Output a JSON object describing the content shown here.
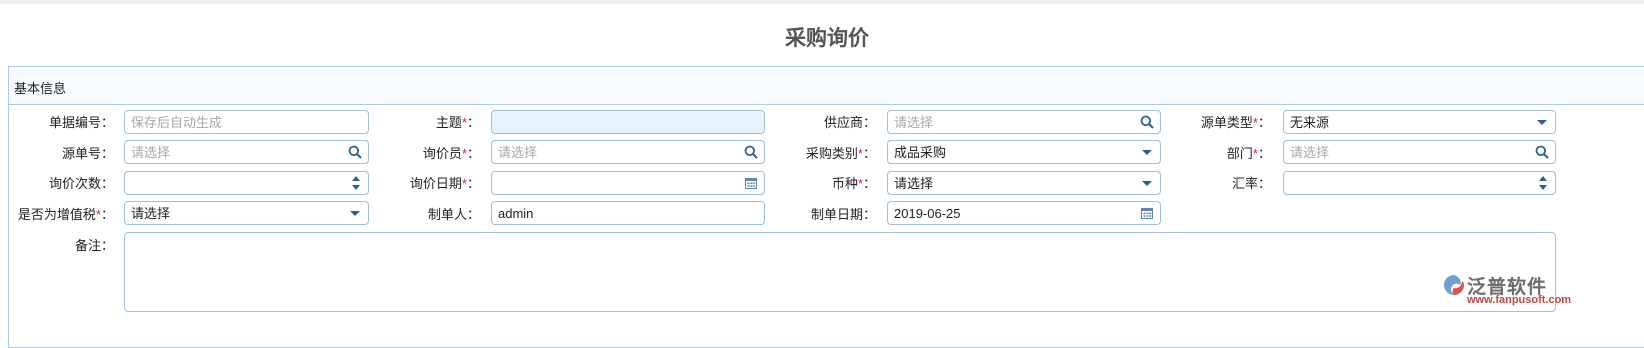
{
  "page": {
    "title": "采购询价"
  },
  "section": {
    "title": "基本信息"
  },
  "fields": {
    "doc_no": {
      "label": "单据编号：",
      "placeholder": "保存后自动生成"
    },
    "subject": {
      "label": "主题",
      "value": ""
    },
    "supplier": {
      "label": "供应商：",
      "placeholder": "请选择"
    },
    "source_type": {
      "label": "源单类型",
      "value": "无来源"
    },
    "source_no": {
      "label": "源单号：",
      "placeholder": "请选择"
    },
    "inquirer": {
      "label": "询价员",
      "placeholder": "请选择"
    },
    "purchase_category": {
      "label": "采购类别",
      "value": "成品采购"
    },
    "department": {
      "label": "部门",
      "placeholder": "请选择"
    },
    "inquiry_count": {
      "label": "询价次数：",
      "value": ""
    },
    "inquiry_date": {
      "label": "询价日期",
      "value": ""
    },
    "currency": {
      "label": "币种",
      "value": "请选择"
    },
    "exchange_rate": {
      "label": "汇率：",
      "value": ""
    },
    "vat": {
      "label": "是否为增值税",
      "value": "请选择"
    },
    "creator": {
      "label": "制单人：",
      "value": "admin"
    },
    "create_date": {
      "label": "制单日期：",
      "value": "2019-06-25"
    },
    "remark": {
      "label": "备注：",
      "value": ""
    }
  },
  "required_mark": "*",
  "required_suffix": "：",
  "logo": {
    "name": "泛普软件",
    "url": "www.fanpusoft.com"
  },
  "colors": {
    "border": "#9ec0dc",
    "required": "#e02020",
    "icon": "#4a7fb5"
  }
}
